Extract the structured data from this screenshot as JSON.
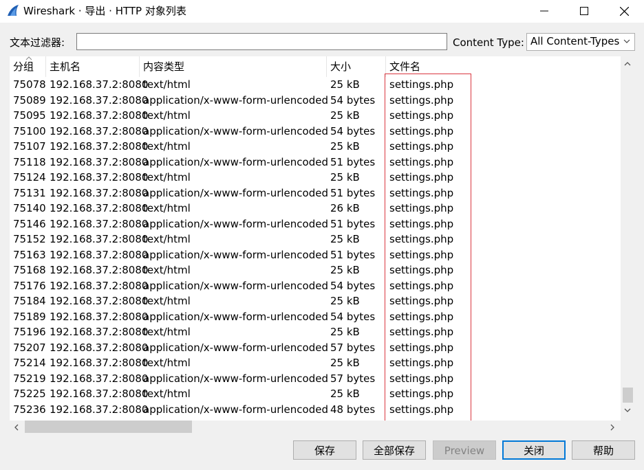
{
  "window": {
    "title": "Wireshark · 导出 · HTTP 对象列表"
  },
  "filter": {
    "label": "文本过滤器:",
    "value": "",
    "content_type_label": "Content Type:",
    "content_type_value": "All Content-Types"
  },
  "table": {
    "headers": [
      "分组",
      "主机名",
      "内容类型",
      "大小",
      "文件名"
    ],
    "rows": [
      [
        "75078",
        "192.168.37.2:8080",
        "text/html",
        "25 kB",
        "settings.php"
      ],
      [
        "75089",
        "192.168.37.2:8080",
        "application/x-www-form-urlencoded",
        "54 bytes",
        "settings.php"
      ],
      [
        "75095",
        "192.168.37.2:8080",
        "text/html",
        "25 kB",
        "settings.php"
      ],
      [
        "75100",
        "192.168.37.2:8080",
        "application/x-www-form-urlencoded",
        "54 bytes",
        "settings.php"
      ],
      [
        "75107",
        "192.168.37.2:8080",
        "text/html",
        "25 kB",
        "settings.php"
      ],
      [
        "75118",
        "192.168.37.2:8080",
        "application/x-www-form-urlencoded",
        "51 bytes",
        "settings.php"
      ],
      [
        "75124",
        "192.168.37.2:8080",
        "text/html",
        "25 kB",
        "settings.php"
      ],
      [
        "75131",
        "192.168.37.2:8080",
        "application/x-www-form-urlencoded",
        "51 bytes",
        "settings.php"
      ],
      [
        "75140",
        "192.168.37.2:8080",
        "text/html",
        "26 kB",
        "settings.php"
      ],
      [
        "75146",
        "192.168.37.2:8080",
        "application/x-www-form-urlencoded",
        "51 bytes",
        "settings.php"
      ],
      [
        "75152",
        "192.168.37.2:8080",
        "text/html",
        "25 kB",
        "settings.php"
      ],
      [
        "75163",
        "192.168.37.2:8080",
        "application/x-www-form-urlencoded",
        "51 bytes",
        "settings.php"
      ],
      [
        "75168",
        "192.168.37.2:8080",
        "text/html",
        "25 kB",
        "settings.php"
      ],
      [
        "75176",
        "192.168.37.2:8080",
        "application/x-www-form-urlencoded",
        "54 bytes",
        "settings.php"
      ],
      [
        "75184",
        "192.168.37.2:8080",
        "text/html",
        "25 kB",
        "settings.php"
      ],
      [
        "75189",
        "192.168.37.2:8080",
        "application/x-www-form-urlencoded",
        "54 bytes",
        "settings.php"
      ],
      [
        "75196",
        "192.168.37.2:8080",
        "text/html",
        "25 kB",
        "settings.php"
      ],
      [
        "75207",
        "192.168.37.2:8080",
        "application/x-www-form-urlencoded",
        "57 bytes",
        "settings.php"
      ],
      [
        "75214",
        "192.168.37.2:8080",
        "text/html",
        "25 kB",
        "settings.php"
      ],
      [
        "75219",
        "192.168.37.2:8080",
        "application/x-www-form-urlencoded",
        "57 bytes",
        "settings.php"
      ],
      [
        "75225",
        "192.168.37.2:8080",
        "text/html",
        "25 kB",
        "settings.php"
      ],
      [
        "75236",
        "192.168.37.2:8080",
        "application/x-www-form-urlencoded",
        "48 bytes",
        "settings.php"
      ]
    ]
  },
  "buttons": {
    "save": "保存",
    "save_all": "全部保存",
    "preview": "Preview",
    "close": "关闭",
    "help": "帮助"
  },
  "colors": {
    "highlight_border": "#d9363e",
    "default_button_border": "#0078d7",
    "app_icon_blue": "#1f5fb4"
  },
  "icons": {
    "app": "wireshark-fin-icon",
    "minimize": "minimize-icon",
    "maximize": "maximize-icon",
    "close": "close-icon",
    "dropdown": "chevron-down-icon"
  }
}
